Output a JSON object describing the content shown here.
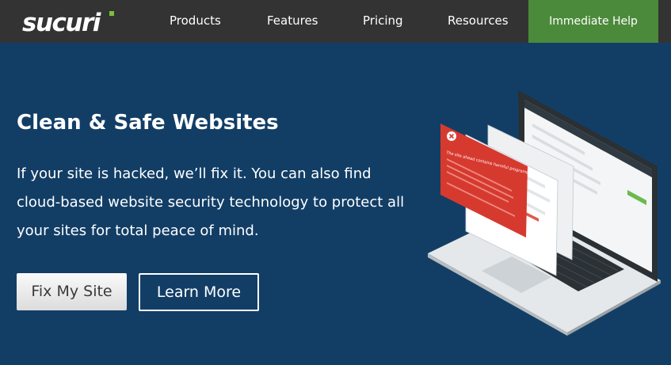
{
  "header": {
    "logo_text": "sucuri",
    "nav": {
      "products": "Products",
      "features": "Features",
      "pricing": "Pricing",
      "resources": "Resources"
    },
    "help_button": "Immediate Help"
  },
  "hero": {
    "title": "Clean & Safe Websites",
    "description": "If your site is hacked, we’ll fix it. You can also find cloud-based website security technology to protect all your sites for total peace of mind.",
    "primary_button": "Fix My Site",
    "secondary_button": "Learn More"
  },
  "illustration": {
    "alert_title": "The site ahead contains harmful programs"
  },
  "colors": {
    "header_bg": "#333333",
    "hero_bg": "#123e66",
    "help_button_bg": "#4c8a3b",
    "logo_accent": "#7bbf3b",
    "alert_red": "#d63a2f"
  }
}
